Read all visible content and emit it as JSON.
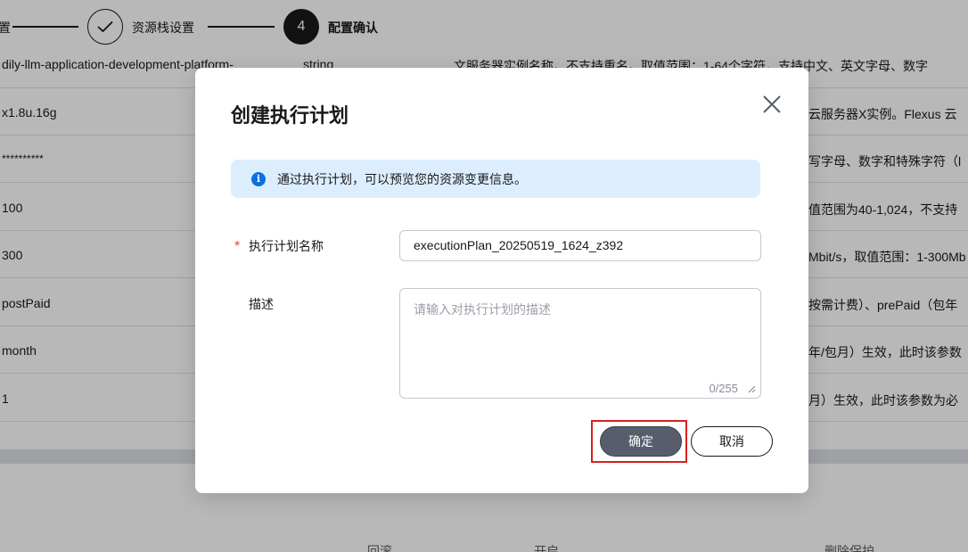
{
  "stepper": {
    "steps": [
      {
        "label": "置",
        "state": "done"
      },
      {
        "label": "资源栈设置",
        "state": "done"
      },
      {
        "label": "配置确认",
        "state": "active",
        "number": "4"
      }
    ]
  },
  "table": {
    "rows": [
      {
        "value": "dily-llm-application-development-platform-",
        "type": "string",
        "desc": "文服务器实例名称。不支持重名。取值范围：1-64个字符，支持中文、英文字母、数字"
      },
      {
        "value": "x1.8u.16g",
        "type": "",
        "desc": "云服务器X实例。Flexus 云"
      },
      {
        "value": "**********",
        "type": "",
        "desc": "写字母、数字和特殊字符（l"
      },
      {
        "value": "100",
        "type": "",
        "desc": "值范围为40-1,024，不支持"
      },
      {
        "value": "300",
        "type": "",
        "desc": "Mbit/s，取值范围：1-300Mb"
      },
      {
        "value": "postPaid",
        "type": "",
        "desc": "按需计费）、prePaid（包年"
      },
      {
        "value": "month",
        "type": "",
        "desc": "年/包月）生效，此时该参数"
      },
      {
        "value": "1",
        "type": "",
        "desc": "月）生效，此时该参数为必"
      }
    ]
  },
  "footer": {
    "labels": [
      "回滚",
      "开启",
      "删除保护"
    ]
  },
  "dialog": {
    "title": "创建执行计划",
    "info": "通过执行计划，可以预览您的资源变更信息。",
    "name_label": "执行计划名称",
    "required_mark": "*",
    "name_value": "executionPlan_20250519_1624_z392",
    "desc_label": "描述",
    "desc_placeholder": "请输入对执行计划的描述",
    "desc_counter": "0/255",
    "ok_label": "确定",
    "cancel_label": "取消"
  },
  "colors": {
    "primary_button": "#575d6c",
    "highlight": "#d9201d",
    "info_bg": "#dceefe",
    "info_icon": "#0f6fde",
    "required": "#e8403e"
  },
  "icons": [
    "check-icon",
    "close-icon",
    "info-icon",
    "resize-icon"
  ]
}
